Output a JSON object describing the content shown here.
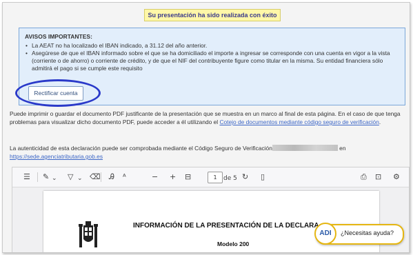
{
  "banner": {
    "success": "Su presentación ha sido realizada con éxito"
  },
  "notice": {
    "title": "AVISOS IMPORTANTES:",
    "item1": "La AEAT no ha localizado el IBAN indicado, a 31.12 del año anterior.",
    "item2": "Asegúrese de que el IBAN informado sobre el que se ha domiciliado el importe a ingresar se corresponde con una cuenta en vigor a la vista (corriente o de ahorro) o corriente de crédito, y de que el NIF del contribuyente figure como titular en la misma. Su entidad financiera sólo admitirá el pago si se cumple este requisito",
    "button": "Rectificar cuenta"
  },
  "body": {
    "para1_text": "Puede imprimir o guardar el documento PDF justificante de la presentación que se muestra en un marco al final de esta página. En el caso de que tenga problemas para visualizar dicho documento PDF, puede acceder a él utilizando el ",
    "para1_link": "Cotejo de documentos mediante código seguro de verificación",
    "para1_end": ".",
    "para2_text": "La autenticidad de esta declaración puede ser comprobada mediante el Código Seguro de Verificación",
    "para2_after": " en",
    "para2_link": "https://sede.agenciatributaria.gob.es"
  },
  "pdf": {
    "page_current": "1",
    "page_total": "de 5",
    "doc_title": "INFORMACIÓN DE LA PRESENTACIÓN DE LA DECLARA",
    "doc_subtitle": "Modelo 200"
  },
  "help": {
    "logo": "ADI",
    "label": "¿Necesitas ayuda?"
  },
  "colors": {
    "annotation": "#2a39c9",
    "link": "#3d67c7",
    "notice_bg": "#e2eefb",
    "banner_bg": "#fff7a8"
  }
}
